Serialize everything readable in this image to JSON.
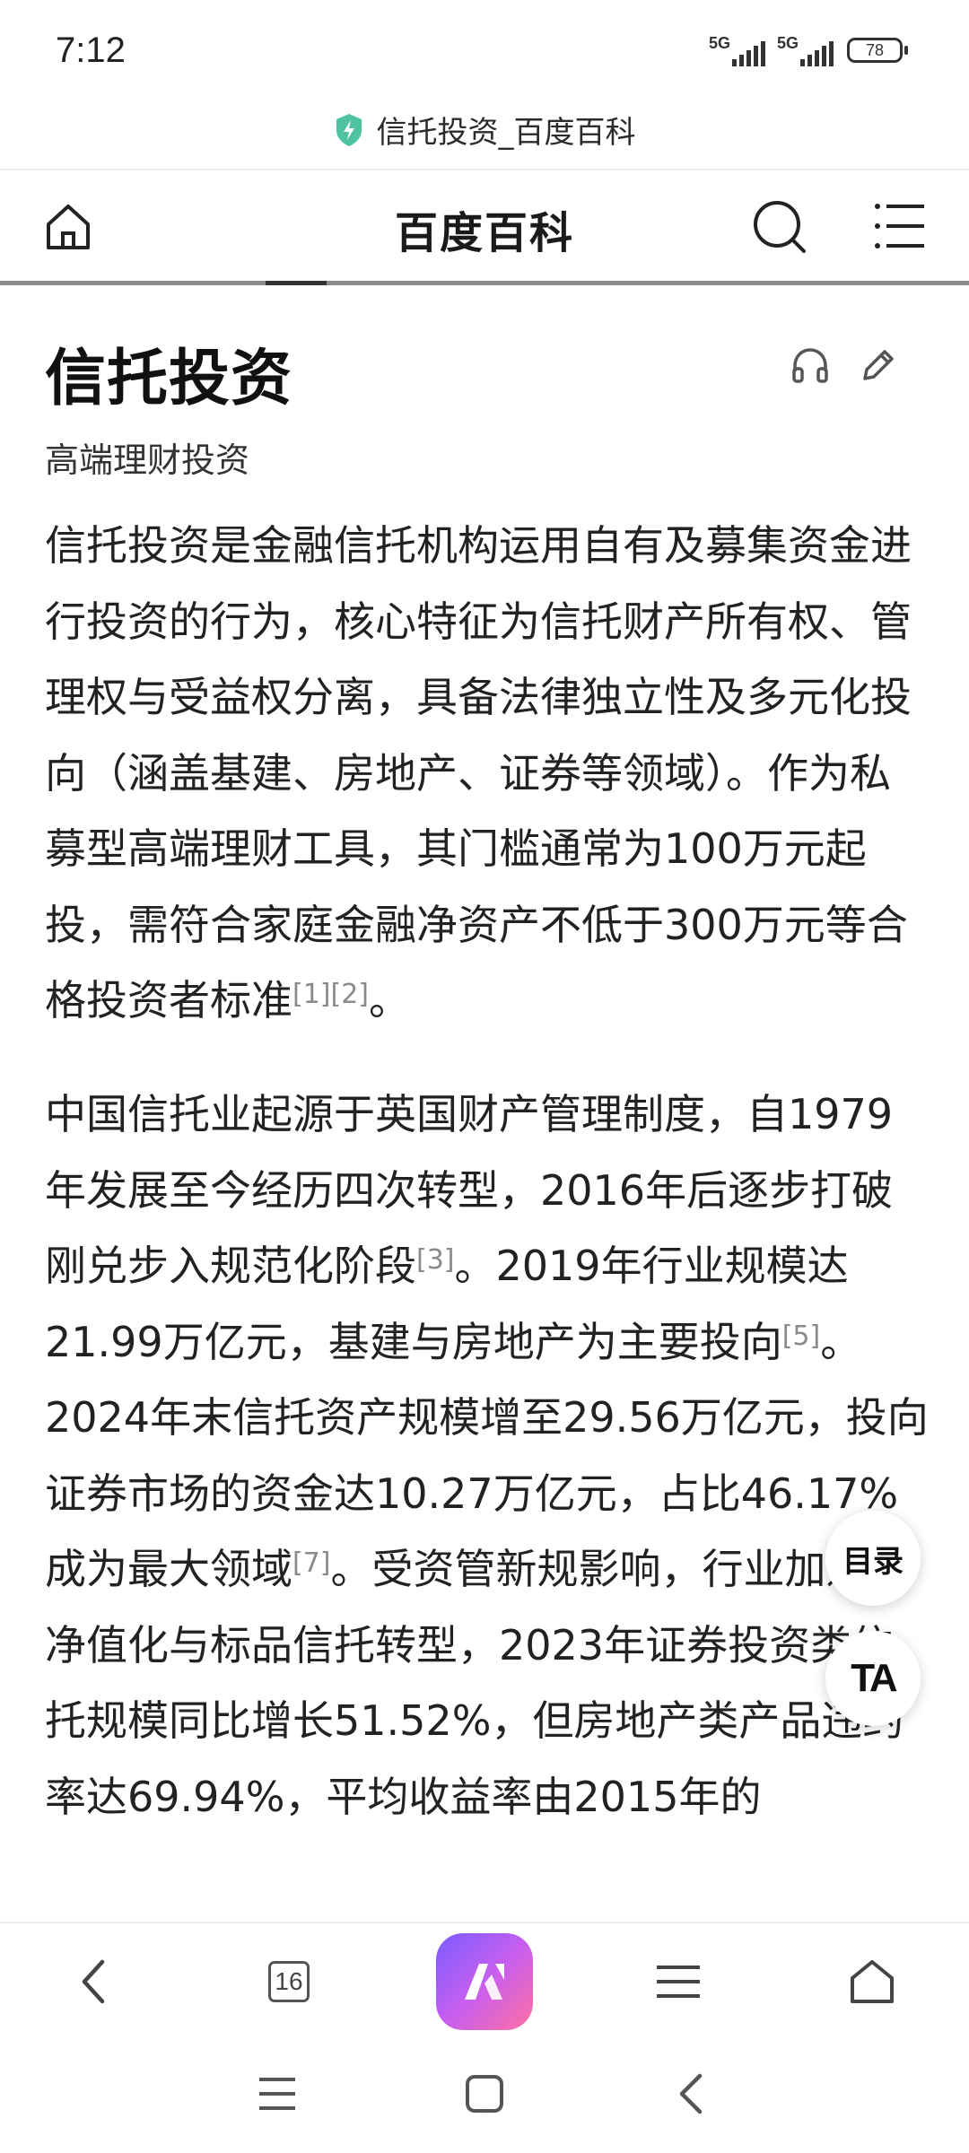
{
  "status_bar": {
    "time": "7:12",
    "signal1_label": "5G",
    "signal2_label": "5G",
    "battery": "78"
  },
  "url_bar": {
    "shield_icon": "shield-bolt-icon",
    "page_title": "信托投资_百度百科",
    "shield_color": "#4fc3a1"
  },
  "site_header": {
    "title": "百度百科",
    "home_icon": "home-icon",
    "search_icon": "search-icon",
    "menu_icon": "menu-list-icon"
  },
  "article": {
    "title": "信托投资",
    "subtitle": "高端理财投资",
    "listen_icon": "headphones-icon",
    "edit_icon": "pencil-icon",
    "paragraph1": {
      "text": "信托投资是金融信托机构运用自有及募集资金进行投资的行为，核心特征为信托财产所有权、管理权与受益权分离，具备法律独立性及多元化投向（涵盖基建、房地产、证券等领域）。作为私募型高端理财工具，其门槛通常为100万元起投，需符合家庭金融净资产不低于300万元等合格投资者标准",
      "refs": "[1][2]",
      "end": "。"
    },
    "paragraph2": {
      "s1": "中国信托业起源于英国财产管理制度，自1979年发展至今经历四次转型，2016年后逐步打破刚兑步入规范化阶段",
      "r1": "[3]",
      "s2": "。2019年行业规模达21.99万亿元，基建与房地产为主要投向",
      "r2": "[5]",
      "s3": "。2024年末信托资产规模增至29.56万亿元，投向证券市场的资金达10.27万亿元，占比46.17%成为最大领域",
      "r3": "[7]",
      "s4": "。受资管新规影响，行业加速向净值化与标品信托转型，2023年证券投资类信托规模同比增长51.52%，但房地产类产品违约率达69.94%，平均收益率由2015年的"
    }
  },
  "floating": {
    "toc_label": "目录",
    "ta_label": "TA"
  },
  "bottom_bar": {
    "back_icon": "chevron-left-icon",
    "tab_count": "16",
    "ai_icon": "ai-assistant-icon",
    "menu_icon": "hamburger-menu-icon",
    "home_icon": "home-outline-icon"
  },
  "nav_bar": {
    "recents_icon": "recents-icon",
    "home_icon": "square-home-icon",
    "back_icon": "back-arrow-icon"
  }
}
